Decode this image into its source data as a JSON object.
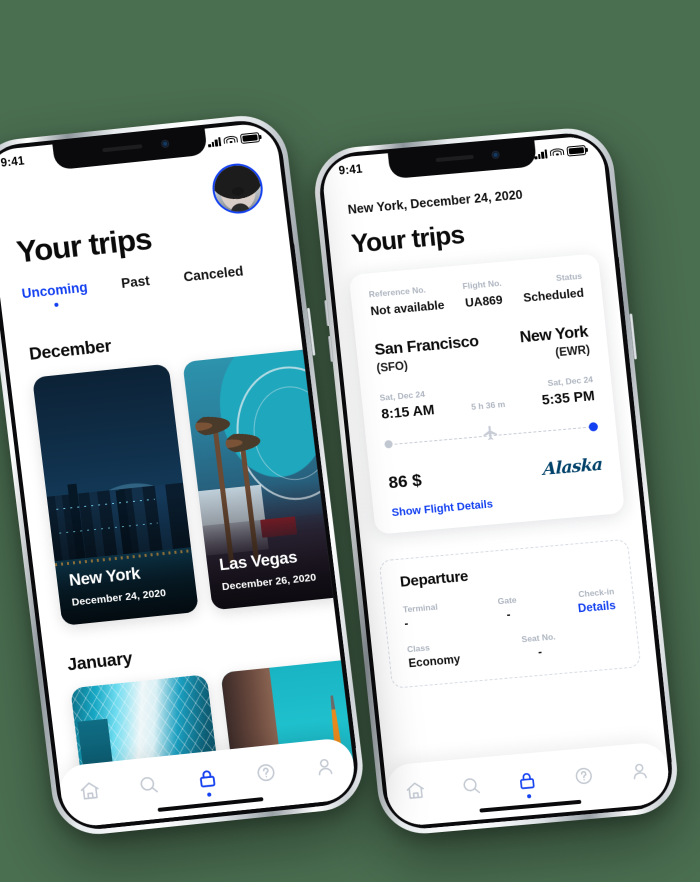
{
  "background_color": "#4a6e50",
  "accent_color": "#1340f0",
  "muted_label_color": "#aeb5c0",
  "left_phone": {
    "status_bar": {
      "time": "9:41",
      "signal_icon": "cellular-signal-icon",
      "wifi_icon": "wifi-icon",
      "battery_icon": "battery-icon"
    },
    "avatar": "user-avatar",
    "title": "Your trips",
    "tabs": [
      {
        "label": "Uncoming",
        "active": true
      },
      {
        "label": "Past",
        "active": false
      },
      {
        "label": "Canceled",
        "active": false
      }
    ],
    "sections": [
      {
        "month": "December",
        "trips": [
          {
            "city": "New York",
            "date": "December 24, 2020"
          },
          {
            "city": "Las Vegas",
            "date": "December 26, 2020"
          }
        ]
      },
      {
        "month": "January",
        "trips": [
          {
            "city": "",
            "date": ""
          },
          {
            "city": "",
            "date": ""
          }
        ]
      }
    ],
    "tabbar": [
      {
        "icon": "home-icon",
        "active": false
      },
      {
        "icon": "search-icon",
        "active": false
      },
      {
        "icon": "lock-icon",
        "active": true
      },
      {
        "icon": "help-icon",
        "active": false
      },
      {
        "icon": "profile-icon",
        "active": false
      }
    ]
  },
  "right_phone": {
    "status_bar": {
      "time": "9:41",
      "signal_icon": "cellular-signal-icon",
      "wifi_icon": "wifi-icon",
      "battery_icon": "battery-icon"
    },
    "breadcrumb": "New York, December 24, 2020",
    "title": "Your trips",
    "flight_card": {
      "meta": [
        {
          "label": "Reference No.",
          "value": "Not available"
        },
        {
          "label": "Flight No.",
          "value": "UA869"
        },
        {
          "label": "Status",
          "value": "Scheduled"
        }
      ],
      "origin_city": "San Francisco",
      "origin_code": "(SFO)",
      "destination_city": "New York",
      "destination_code": "(EWR)",
      "depart_date": "Sat, Dec 24",
      "depart_time": "8:15 AM",
      "duration": "5 h 36 m",
      "arrive_date": "Sat, Dec 24",
      "arrive_time": "5:35 PM",
      "price": "86 $",
      "airline": "Alaska",
      "details_link": "Show Flight Details",
      "plane_icon": "airplane-icon"
    },
    "departure": {
      "heading": "Departure",
      "fields": [
        {
          "label": "Terminal",
          "value": "-",
          "link": false
        },
        {
          "label": "Gate",
          "value": "-",
          "link": false
        },
        {
          "label": "Check-in",
          "value": "Details",
          "link": true
        },
        {
          "label": "Class",
          "value": "Economy",
          "link": false
        },
        {
          "label": "Seat No.",
          "value": "-",
          "link": false
        }
      ]
    },
    "tabbar": [
      {
        "icon": "home-icon",
        "active": false
      },
      {
        "icon": "search-icon",
        "active": false
      },
      {
        "icon": "lock-icon",
        "active": true
      },
      {
        "icon": "help-icon",
        "active": false
      },
      {
        "icon": "profile-icon",
        "active": false
      }
    ]
  }
}
